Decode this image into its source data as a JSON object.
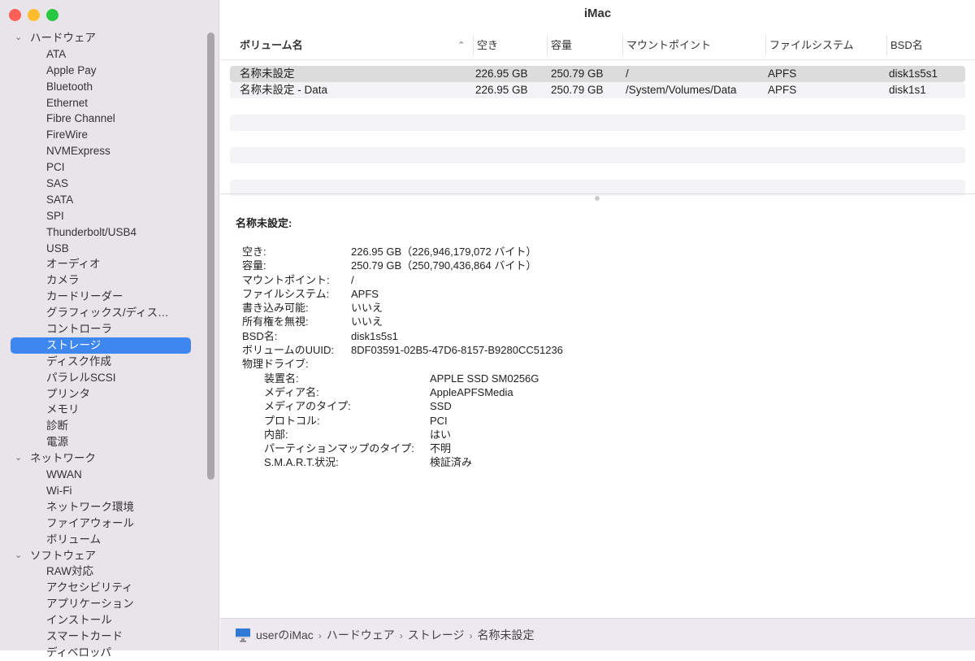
{
  "window": {
    "title": "iMac",
    "colors": {
      "close": "#fe5f57",
      "minimize": "#febc2e",
      "zoom": "#28c840",
      "accent": "#3d87ee"
    }
  },
  "sidebar": {
    "categories": [
      {
        "label": "ハードウェア",
        "items": [
          "ATA",
          "Apple Pay",
          "Bluetooth",
          "Ethernet",
          "Fibre Channel",
          "FireWire",
          "NVMExpress",
          "PCI",
          "SAS",
          "SATA",
          "SPI",
          "Thunderbolt/USB4",
          "USB",
          "オーディオ",
          "カメラ",
          "カードリーダー",
          "グラフィックス/ディス…",
          "コントローラ",
          "ストレージ",
          "ディスク作成",
          "パラレルSCSI",
          "プリンタ",
          "メモリ",
          "診断",
          "電源"
        ]
      },
      {
        "label": "ネットワーク",
        "items": [
          "WWAN",
          "Wi-Fi",
          "ネットワーク環境",
          "ファイアウォール",
          "ボリューム"
        ]
      },
      {
        "label": "ソフトウェア",
        "items": [
          "RAW対応",
          "アクセシビリティ",
          "アプリケーション",
          "インストール",
          "スマートカード",
          "ディベロッパ"
        ]
      }
    ],
    "selected": "ストレージ"
  },
  "table": {
    "columns": [
      "ボリューム名",
      "空き",
      "容量",
      "マウントポイント",
      "ファイルシステム",
      "BSD名"
    ],
    "rows": [
      [
        "名称未設定",
        "226.95 GB",
        "250.79 GB",
        "/",
        "APFS",
        "disk1s5s1"
      ],
      [
        "名称未設定 - Data",
        "226.95 GB",
        "250.79 GB",
        "/System/Volumes/Data",
        "APFS",
        "disk1s1"
      ]
    ]
  },
  "detail": {
    "title": "名称未設定:",
    "fields": [
      [
        "空き:",
        "226.95 GB（226,946,179,072 バイト）"
      ],
      [
        "容量:",
        "250.79 GB（250,790,436,864 バイト）"
      ],
      [
        "マウントポイント:",
        "/"
      ],
      [
        "ファイルシステム:",
        "APFS"
      ],
      [
        "書き込み可能:",
        "いいえ"
      ],
      [
        "所有権を無視:",
        "いいえ"
      ],
      [
        "BSD名:",
        "disk1s5s1"
      ],
      [
        "ボリュームのUUID:",
        "8DF03591-02B5-47D6-8157-B9280CC51236"
      ],
      [
        "物理ドライブ:",
        ""
      ]
    ],
    "physical": [
      [
        "装置名:",
        "APPLE SSD SM0256G"
      ],
      [
        "メディア名:",
        "AppleAPFSMedia"
      ],
      [
        "メディアのタイプ:",
        "SSD"
      ],
      [
        "プロトコル:",
        "PCI"
      ],
      [
        "内部:",
        "はい"
      ],
      [
        "パーティションマップのタイプ:",
        "不明"
      ],
      [
        "S.M.A.R.T.状況:",
        "検証済み"
      ]
    ]
  },
  "footer": {
    "path": [
      "userのiMac",
      "ハードウェア",
      "ストレージ",
      "名称未設定"
    ]
  }
}
